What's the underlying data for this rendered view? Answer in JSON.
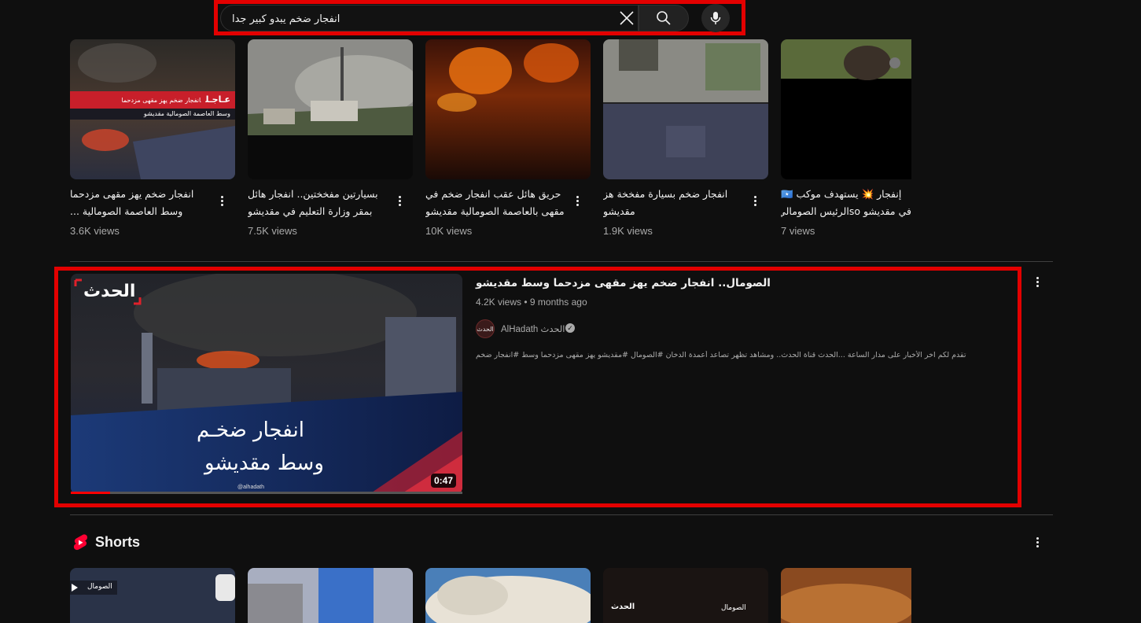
{
  "search": {
    "query": "انفجار ضخم يبدو كبير جدا",
    "placeholder": "Search"
  },
  "top_videos": [
    {
      "title_line1": "انفجار ضخم يهز مقهى مزدحما",
      "title_line2": "وسط العاصمة الصومالية ...",
      "views": "3.6K views",
      "overlay_banner": "عـاجـل",
      "overlay_text1": "انفجار ضخم يهز مقهى مزدحما",
      "overlay_text2": "وسط العاصمة الصومالية مقديشو"
    },
    {
      "title_line1": "بسيارتين مفخختين.. انفجار هائل",
      "title_line2": "بمقر وزارة التعليم في مقديشو",
      "views": "7.5K views"
    },
    {
      "title_line1": "حريق هائل عقب انفجار ضخم في",
      "title_line2": "مقهى بالعاصمة الصومالية مقديشو",
      "views": "10K views"
    },
    {
      "title_line1": "انفجار ضخم بسيارة مفخخة هز",
      "title_line2": "مقديشو",
      "views": "1.9K views"
    },
    {
      "title_line1": "إنفجار 💥 يستهدف موكب 🇸🇴",
      "title_line2": "في مقديشو soالرئيس الصومالي",
      "views": "7 views"
    }
  ],
  "featured": {
    "title": "الصومال.. انفجار ضخم يهز مقهى مزدحما وسط مقديشو",
    "views": "4.2K views",
    "age": "9 months ago",
    "meta_sep": "•",
    "channel": "AlHadath الحدث",
    "avatar_text": "الحدث",
    "description": "تقدم لكم آخر الأخبار على مدار الساعة ...الحدث قناة الحدث.. ومشاهد تظهر تصاعد أعمدة الدخان #الصومال #مقديشو يهز مقهى مزدحما وسط #انفجار ضخم",
    "duration": "0:47",
    "progress": 0.1,
    "thumb_logo": "الحدث",
    "thumb_line1": "انفجار ضخـم",
    "thumb_line2": "وسط مقديشو",
    "thumb_handle": "@alhadath"
  },
  "shorts": {
    "title": "Shorts",
    "items": [
      {
        "label": "الصومال"
      },
      {
        "label": ""
      },
      {
        "label": ""
      },
      {
        "label": "الحدث",
        "label2": "الصومال"
      },
      {
        "label": ""
      }
    ]
  },
  "colors": {
    "background": "#0f0f0f",
    "highlight": "#e30000",
    "text_primary": "#f1f1f1",
    "text_secondary": "#aaaaaa"
  }
}
